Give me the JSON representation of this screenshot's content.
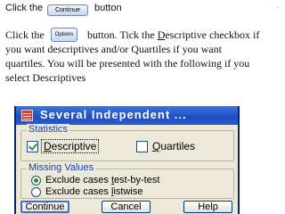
{
  "instructions": {
    "line1_before": "Click the",
    "line1_after": "button",
    "continue_button_label": "Continue",
    "line2_before": "Click the",
    "options_button_label": "Options",
    "line2_after": "button. Tick the Descriptive checkbox if",
    "line3": "you want descriptives and/or Quartiles if you want",
    "line4": "quartiles. You will be presented with the following if you",
    "line5": "select Descriptives"
  },
  "dialog": {
    "title": "Several Independent ...",
    "statistics_group": {
      "label": "Statistics",
      "descriptive": {
        "label": "Descriptive",
        "checked": true
      },
      "quartiles": {
        "label": "Quartiles",
        "checked": false
      }
    },
    "missing_values_group": {
      "label": "Missing Values",
      "options": [
        {
          "label": "Exclude cases test-by-test",
          "selected": true
        },
        {
          "label": "Exclude cases listwise",
          "selected": false
        }
      ]
    },
    "buttons": {
      "continue": "Continue",
      "cancel": "Cancel",
      "help": "Help"
    }
  },
  "colors": {
    "title_bar": "#2a5bd0",
    "group_label": "#1a3fb0",
    "check_mark": "#2f8f2f"
  }
}
